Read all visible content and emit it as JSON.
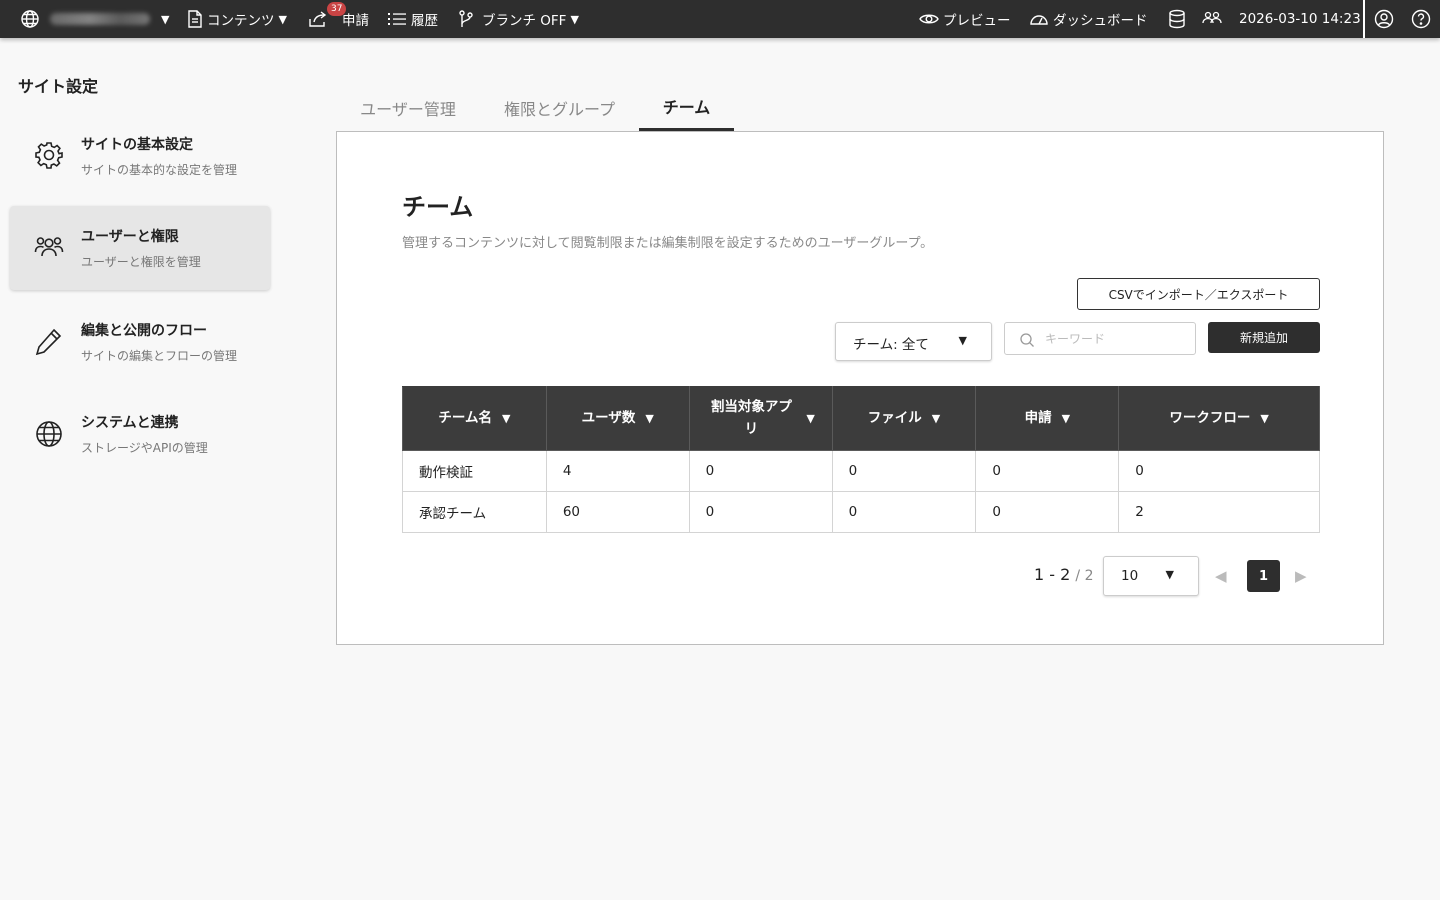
{
  "topbar": {
    "contents_label": "コンテンツ",
    "requests_label": "申請",
    "requests_badge": "37",
    "history_label": "履歴",
    "branch_label": "ブランチ OFF",
    "preview_label": "プレビュー",
    "dashboard_label": "ダッシュボード",
    "datetime": "2026-03-10 14:23"
  },
  "sidebar": {
    "title": "サイト設定",
    "items": [
      {
        "label": "サイトの基本設定",
        "desc": "サイトの基本的な設定を管理",
        "icon": "gear-icon"
      },
      {
        "label": "ユーザーと権限",
        "desc": "ユーザーと権限を管理",
        "icon": "users-icon"
      },
      {
        "label": "編集と公開のフロー",
        "desc": "サイトの編集とフローの管理",
        "icon": "pencil-icon"
      },
      {
        "label": "システムと連携",
        "desc": "ストレージやAPIの管理",
        "icon": "globe-icon"
      }
    ]
  },
  "tabs": [
    "ユーザー管理",
    "権限とグループ",
    "チーム"
  ],
  "main": {
    "title": "チーム",
    "description": "管理するコンテンツに対して閲覧制限または編集制限を設定するためのユーザーグループ。",
    "csv_button": "CSVでインポート／エクスポート",
    "team_filter": "チーム: 全て",
    "search_placeholder": "キーワード",
    "add_button": "新規追加"
  },
  "table": {
    "columns": [
      "チーム名",
      "ユーザ数",
      "割当対象アプリ",
      "ファイル",
      "申請",
      "ワークフロー"
    ],
    "rows": [
      [
        "動作検証",
        "4",
        "0",
        "0",
        "0",
        "0"
      ],
      [
        "承認チーム",
        "60",
        "0",
        "0",
        "0",
        "2"
      ]
    ]
  },
  "pagination": {
    "range": "1 - 2",
    "total": "/ 2",
    "page_size": "10",
    "current_page": "1"
  },
  "colors": {
    "topbar_bg": "#2e2e2e",
    "badge": "#c94444",
    "header_bg": "#3c3c3c",
    "active_sidebar_bg": "#e6e6e6"
  }
}
